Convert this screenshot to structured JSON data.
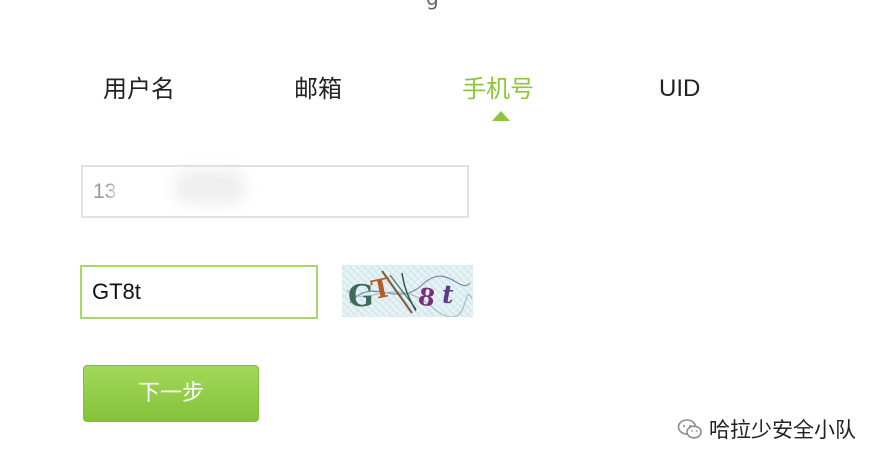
{
  "header": {
    "top_cut_text": "g"
  },
  "tabs": [
    {
      "label": "用户名",
      "active": false
    },
    {
      "label": "邮箱",
      "active": false
    },
    {
      "label": "手机号",
      "active": true
    },
    {
      "label": "UID",
      "active": false
    }
  ],
  "form": {
    "phone_value": "13",
    "captcha_value": "GT8t",
    "captcha_image_text": "GT8t",
    "next_label": "下一步"
  },
  "watermark": {
    "icon": "wechat-icon",
    "text": "哈拉少安全小队"
  },
  "colors": {
    "accent": "#8cc63f",
    "captcha_border": "#a8d86b",
    "button_top": "#a3d85a",
    "button_bottom": "#84c23a"
  }
}
